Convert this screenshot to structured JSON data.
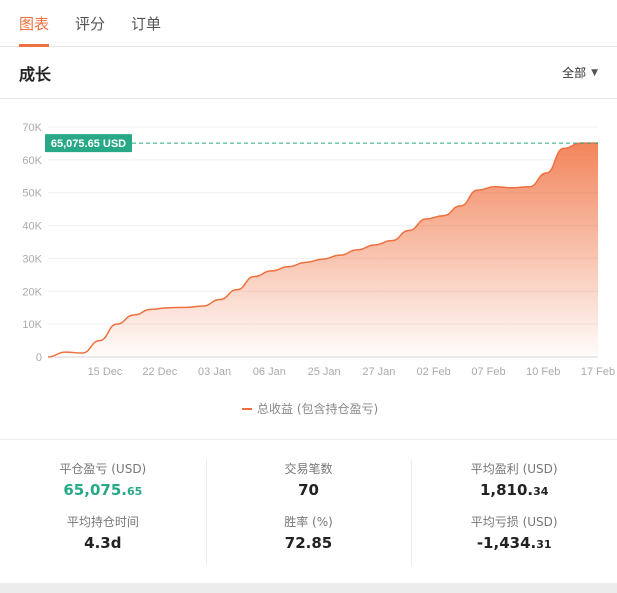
{
  "tabs": [
    {
      "label": "图表",
      "active": true
    },
    {
      "label": "评分",
      "active": false
    },
    {
      "label": "订单",
      "active": false
    }
  ],
  "section": {
    "title": "成长",
    "filter_label": "全部",
    "filter_icon": "caret-down-icon"
  },
  "colors": {
    "accent": "#f0703f",
    "teal": "#27a887"
  },
  "chart_data": {
    "type": "area",
    "y_ticks": [
      "0",
      "10K",
      "20K",
      "30K",
      "40K",
      "50K",
      "60K",
      "70K"
    ],
    "ylim": [
      0,
      70000
    ],
    "x_ticks": [
      "15 Dec",
      "22 Dec",
      "03 Jan",
      "06 Jan",
      "25 Jan",
      "27 Jan",
      "02 Feb",
      "07 Feb",
      "10 Feb",
      "17 Feb"
    ],
    "series": [
      {
        "name": "总收益 (包含持仓盈亏)",
        "values": [
          0,
          1500,
          1200,
          5000,
          10000,
          12800,
          14500,
          15000,
          15100,
          15500,
          17500,
          20500,
          24500,
          26200,
          27500,
          28800,
          29800,
          31000,
          32600,
          34100,
          35400,
          38500,
          42000,
          43000,
          46000,
          50800,
          51800,
          51500,
          51800,
          56000,
          63500,
          65075,
          65075
        ]
      }
    ],
    "highlight": {
      "value": 65075.65,
      "label": "65,075.65 USD"
    },
    "grid": true,
    "legend_position": "bottom"
  },
  "stats": {
    "realized_pnl": {
      "label": "平仓盈亏 (USD)",
      "int": "65,075.",
      "dec": "65"
    },
    "trade_count": {
      "label": "交易笔数",
      "value": "70"
    },
    "avg_profit": {
      "label": "平均盈利 (USD)",
      "int": "1,810.",
      "dec": "34"
    },
    "avg_hold_time": {
      "label": "平均持仓时间",
      "value": "4.3d"
    },
    "win_rate": {
      "label": "胜率 (%)",
      "value": "72.85"
    },
    "avg_loss": {
      "label": "平均亏损 (USD)",
      "int": "-1,434.",
      "dec": "31"
    }
  }
}
